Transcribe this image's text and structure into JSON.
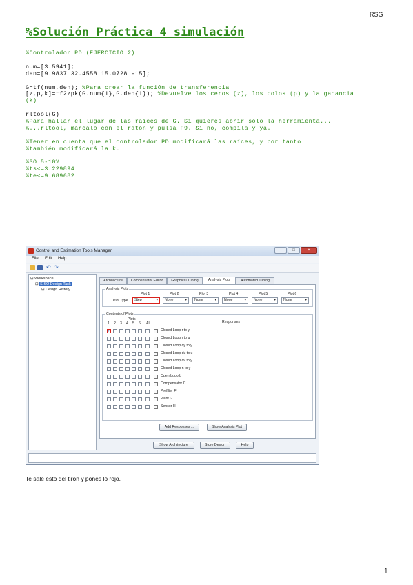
{
  "header": {
    "author": "RSG"
  },
  "page_number": "1",
  "title": "%Solución Práctica 4 simulación",
  "code_lines": [
    {
      "text": "%Controlador PD (EJERCICIO 2)",
      "kind": "comment"
    },
    {
      "text": "",
      "kind": "code"
    },
    {
      "text": "num=[3.5941];",
      "kind": "code"
    },
    {
      "text": "den=[9.9837 32.4558 15.0728 -15];",
      "kind": "code"
    },
    {
      "text": "",
      "kind": "code"
    },
    {
      "text": "G=tf(num,den); ",
      "kind": "code",
      "comment": "%Para crear la función de transferencia"
    },
    {
      "text": "[z,p,k]=tf2zpk(G.num{1},G.den{1}); ",
      "kind": "code",
      "comment": "%Devuelve los ceros (z), los polos (p) y la ganancia"
    },
    {
      "text": "(k)",
      "kind": "comment"
    },
    {
      "text": "",
      "kind": "code"
    },
    {
      "text": "rltool(G)",
      "kind": "code"
    },
    {
      "text": "%Para hallar el lugar de las raíces de G. Si quieres abrir sólo la herramienta...",
      "kind": "comment"
    },
    {
      "text": "%...rltool, márcalo con el ratón y pulsa F9. Si no, compila y ya.",
      "kind": "comment"
    },
    {
      "text": "",
      "kind": "code"
    },
    {
      "text": "%Tener en cuenta que el controlador PD modificará las raíces, y por tanto",
      "kind": "comment"
    },
    {
      "text": "%también modificará la k.",
      "kind": "comment"
    },
    {
      "text": "",
      "kind": "code"
    },
    {
      "text": "%SO 5-10%",
      "kind": "comment"
    },
    {
      "text": "%ts<=3.229894",
      "kind": "comment"
    },
    {
      "text": "%te<=9.689682",
      "kind": "comment"
    }
  ],
  "window": {
    "title": "Control and Estimation Tools Manager",
    "menu": [
      "File",
      "Edit",
      "Help"
    ],
    "tree": [
      "Workspace",
      "SISO Design Task",
      "Design History"
    ],
    "tabs": [
      "Architecture",
      "Compensator Editor",
      "Graphical Tuning",
      "Analysis Plots",
      "Automated Tuning"
    ],
    "analysis_plots_label": "Analysis Plots",
    "plot_headers": [
      "Plot 1",
      "Plot 2",
      "Plot 3",
      "Plot 4",
      "Plot 5",
      "Plot 6"
    ],
    "plot_type_label": "Plot Type",
    "plot_types": [
      "Step",
      "None",
      "None",
      "None",
      "None",
      "None"
    ],
    "contents_label": "Contents of Plots",
    "plots_label": "Plots",
    "plot_cols": [
      "1",
      "2",
      "3",
      "4",
      "5",
      "6",
      "All"
    ],
    "responses_label": "Responses",
    "responses": [
      "Closed Loop r to y",
      "Closed Loop r to u",
      "Closed Loop dy to y",
      "Closed Loop du to u",
      "Closed Loop dv to y",
      "Closed Loop n to y",
      "Open Loop L",
      "Compensator C",
      "Prefilter F",
      "Plant G",
      "Sensor H"
    ],
    "add_responses": "Add Responses ...",
    "show_analysis_plot": "Show Analysis Plot",
    "show_architecture": "Show Architecture",
    "store_design": "Store Design",
    "help": "Help"
  },
  "caption": "Te sale esto del tirón y pones lo rojo."
}
